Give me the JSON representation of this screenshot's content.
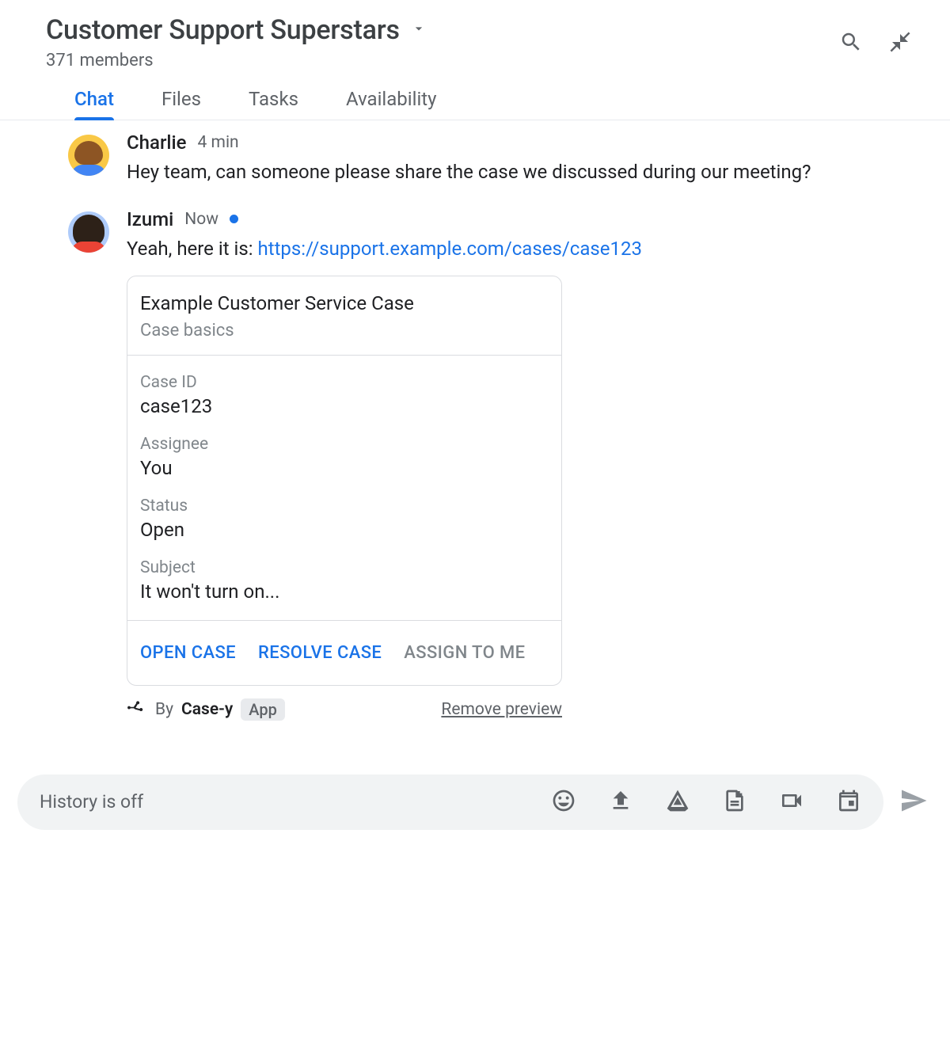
{
  "header": {
    "title": "Customer Support Superstars",
    "members": "371 members"
  },
  "tabs": [
    {
      "label": "Chat",
      "active": true
    },
    {
      "label": "Files",
      "active": false
    },
    {
      "label": "Tasks",
      "active": false
    },
    {
      "label": "Availability",
      "active": false
    }
  ],
  "messages": {
    "m0": {
      "author": "Charlie",
      "time": "4 min",
      "text": "Hey team, can someone please share the case we discussed during our meeting?"
    },
    "m1": {
      "author": "Izumi",
      "time": "Now",
      "text_prefix": "Yeah, here it is: ",
      "link": "https://support.example.com/cases/case123"
    }
  },
  "card": {
    "title": "Example Customer Service Case",
    "subtitle": "Case basics",
    "fields": {
      "case_id_label": "Case ID",
      "case_id_value": "case123",
      "assignee_label": "Assignee",
      "assignee_value": "You",
      "status_label": "Status",
      "status_value": "Open",
      "subject_label": "Subject",
      "subject_value": "It won't turn on..."
    },
    "actions": {
      "open": "Open case",
      "resolve": "Resolve case",
      "assign": "Assign to me"
    }
  },
  "preview_footer": {
    "by": "By",
    "app_name": "Case-y",
    "badge": "App",
    "remove": "Remove preview"
  },
  "composer": {
    "placeholder": "History is off"
  }
}
